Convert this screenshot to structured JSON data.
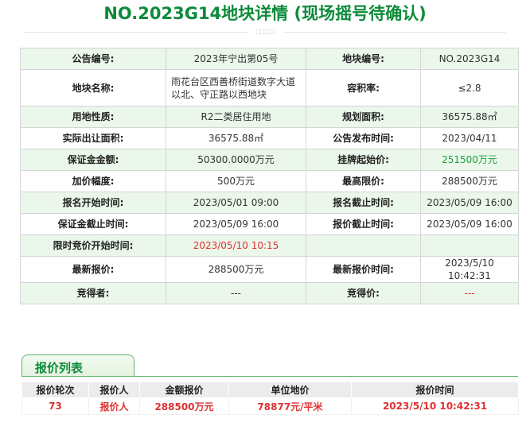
{
  "title": "NO.2023G14地块详情 (现场摇号待确认)",
  "ornament": "□□□",
  "detail": {
    "rows": [
      {
        "k1": "公告编号:",
        "v1": "2023年宁出第05号",
        "k2": "地块编号:",
        "v2": "NO.2023G14"
      },
      {
        "k1": "地块名称:",
        "v1": "雨花台区西善桥街道数字大道以北、守正路以西地块",
        "k2": "容积率:",
        "v2": "≤2.8"
      },
      {
        "k1": "用地性质:",
        "v1": "R2二类居住用地",
        "k2": "规划面积:",
        "v2": "36575.88㎡"
      },
      {
        "k1": "实际出让面积:",
        "v1": "36575.88㎡",
        "k2": "公告发布时间:",
        "v2": "2023/04/11"
      },
      {
        "k1": "保证金金额:",
        "v1": "50300.0000万元",
        "k2": "挂牌起始价:",
        "v2": "251500万元"
      },
      {
        "k1": "加价幅度:",
        "v1": "500万元",
        "k2": "最高限价:",
        "v2": "288500万元"
      },
      {
        "k1": "报名开始时间:",
        "v1": "2023/05/01 09:00",
        "k2": "报名截止时间:",
        "v2": "2023/05/09 16:00"
      },
      {
        "k1": "保证金截止时间:",
        "v1": "2023/05/09 16:00",
        "k2": "报价截止时间:",
        "v2": "2023/05/09 16:00"
      },
      {
        "k1": "限时竞价开始时间:",
        "v1": "2023/05/10 10:15",
        "k2": "",
        "v2": ""
      },
      {
        "k1": "最新报价:",
        "v1": "288500万元",
        "k2": "最新报价时间:",
        "v2": "2023/5/10 10:42:31"
      },
      {
        "k1": "竞得者:",
        "v1": "---",
        "k2": "竞得价:",
        "v2": "---"
      }
    ]
  },
  "quote_list": {
    "tab_label": "报价列表",
    "headers": [
      "报价轮次",
      "报价人",
      "金额报价",
      "单位地价",
      "报价时间"
    ],
    "rows": [
      {
        "round": "73",
        "bidder": "报价人",
        "amount": "288500万元",
        "unit_price": "78877元/平米",
        "time": "2023/5/10 10:42:31"
      }
    ]
  },
  "colors": {
    "title_green": "#0d8b3a",
    "row_tint": "#eaf7ea",
    "price_green": "#19a03c",
    "alert_red": "#e03131"
  }
}
